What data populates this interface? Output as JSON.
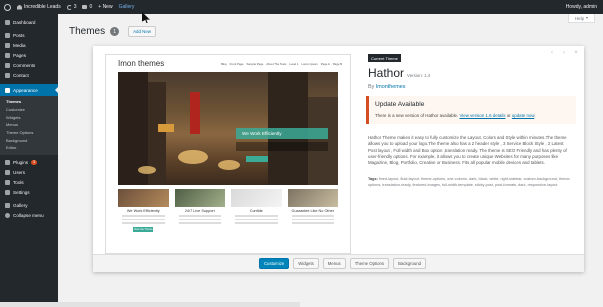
{
  "admin_bar": {
    "site_name": "Incredible Leads",
    "updates_count": "3",
    "comments_count": "0",
    "new_label": "+ New",
    "gallery_label": "Gallery",
    "greeting": "Howdy, admin"
  },
  "sidebar": {
    "items_top": [
      {
        "label": "Dashboard",
        "icon": "dashboard-icon"
      },
      {
        "label": "Posts",
        "icon": "pin-icon"
      },
      {
        "label": "Media",
        "icon": "media-icon"
      },
      {
        "label": "Pages",
        "icon": "page-icon"
      },
      {
        "label": "Comments",
        "icon": "comment-icon"
      },
      {
        "label": "Contact",
        "icon": "contact-icon"
      }
    ],
    "active": {
      "label": "Appearance",
      "icon": "brush-icon"
    },
    "submenu": [
      "Themes",
      "Customize",
      "Widgets",
      "Menus",
      "Theme Options",
      "Background",
      "Editor"
    ],
    "items_bottom": [
      {
        "label": "Plugins",
        "icon": "plugin-icon",
        "badge": "3"
      },
      {
        "label": "Users",
        "icon": "users-icon"
      },
      {
        "label": "Tools",
        "icon": "tools-icon"
      },
      {
        "label": "Settings",
        "icon": "settings-icon"
      },
      {
        "label": "Gallery",
        "icon": "gallery-icon"
      },
      {
        "label": "Collapse menu",
        "icon": "collapse-icon"
      }
    ]
  },
  "header": {
    "title": "Themes",
    "count": "1",
    "add_new": "Add New",
    "help": "Help"
  },
  "theme_preview": {
    "logo": "Imon themes",
    "nav": [
      "Blog",
      "Front Page",
      "Sample Page",
      "About The Tests",
      "Level 1",
      "Lorem Ipsum",
      "Page A",
      "Page B"
    ],
    "caption": "We Work Efficiently",
    "features": [
      {
        "title": "We Work Efficiently",
        "button": "View the Theme"
      },
      {
        "title": "24/7 Live Support"
      },
      {
        "title": "Confide"
      },
      {
        "title": "Guarantee Like No Other"
      }
    ]
  },
  "theme_info": {
    "current_tag": "Current Theme",
    "name": "Hathor",
    "version": "Version: 1.4",
    "author_prefix": "By ",
    "author": "Imonthemes",
    "notice_title": "Update Available",
    "notice_pre": "There is a new version of Hathor available. ",
    "notice_link1": "View version 1.6 details",
    "notice_mid": " or ",
    "notice_link2": "update now",
    "notice_post": ".",
    "description": "Hathor Theme makes it easy to fully customize the Layout, Colors and Style within minutes.The theme allows you to upload your logo.The theme also has a 2 header style , 3 Service Block Style , 2 Latest Post layout , Full width and Box option ,translation ready. The theme is SEO Friendly and has plenty of user-friendly options. For example, it allows you to create unique Websites for many purposes like Magazine, Blog, Portfolio, Creative or Business. Fits all popular mobile devices and tablets.",
    "tags_label": "Tags:",
    "tags": " fixed-layout, fluid-layout, theme-options, one-column, dark, black, white, right-sidebar, custom-background, theme-options, translation-ready, featured-images, full-width-template, sticky-post, post-formats, dark, responsive-layout"
  },
  "actions": [
    "Customize",
    "Widgets",
    "Menus",
    "Theme Options",
    "Background"
  ],
  "colors": {
    "admin_dark": "#23282d",
    "accent": "#0073aa",
    "primary_button": "#0085ba",
    "notice_border": "#d54e21",
    "theme_teal": "#3baa96"
  }
}
